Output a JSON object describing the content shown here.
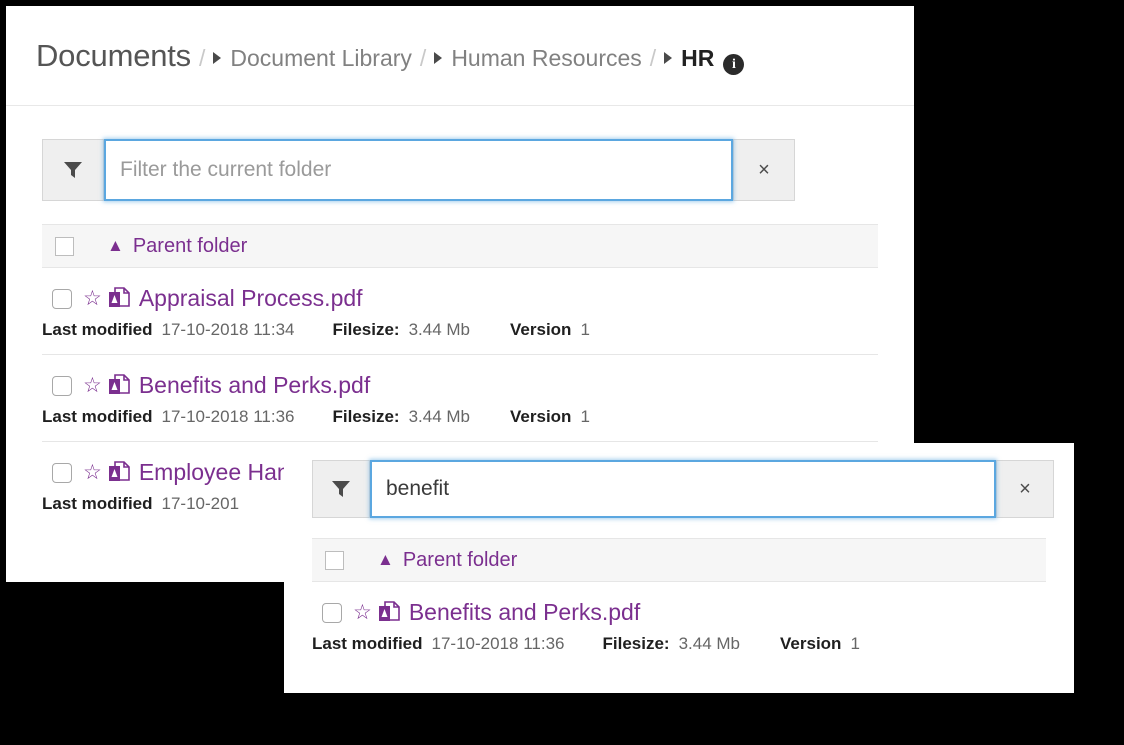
{
  "window_back": {
    "breadcrumb": {
      "root": "Documents",
      "separator": "/",
      "items": [
        {
          "label": "Document Library",
          "current": false
        },
        {
          "label": "Human Resources",
          "current": false
        },
        {
          "label": "HR",
          "current": true
        }
      ],
      "info_glyph": "i",
      "arrow_icon": "triangle-right-icon"
    },
    "filter": {
      "filter_icon": "funnel-icon",
      "value": "",
      "placeholder": "Filter the current folder",
      "clear_label": "×"
    },
    "parent_folder": {
      "label": "Parent folder",
      "caret": "▲"
    },
    "meta_headers": {
      "last_modified": "Last modified",
      "filesize": "Filesize:",
      "version": "Version"
    },
    "files": [
      {
        "name": "Appraisal Process.pdf",
        "last_modified": "17-10-2018 11:34",
        "filesize": "3.44 Mb",
        "version": "1"
      },
      {
        "name": "Benefits and Perks.pdf",
        "last_modified": "17-10-2018 11:36",
        "filesize": "3.44 Mb",
        "version": "1"
      },
      {
        "name": "Employee Han",
        "last_modified": "17-10-201",
        "filesize": "",
        "version": ""
      }
    ]
  },
  "window_front": {
    "filter": {
      "filter_icon": "funnel-icon",
      "value": "benefit",
      "placeholder": "Filter the current folder",
      "clear_label": "×"
    },
    "parent_folder": {
      "label": "Parent folder",
      "caret": "▲"
    },
    "meta_headers": {
      "last_modified": "Last modified",
      "filesize": "Filesize:",
      "version": "Version"
    },
    "files": [
      {
        "name": "Benefits and Perks.pdf",
        "last_modified": "17-10-2018 11:36",
        "filesize": "3.44 Mb",
        "version": "1"
      }
    ]
  },
  "colors": {
    "link_purple": "#7b2f8f",
    "focus_blue": "#5ba7e0",
    "page_background": "#ffffff",
    "canvas_background": "#000000",
    "row_header_gray": "#f6f6f6"
  }
}
